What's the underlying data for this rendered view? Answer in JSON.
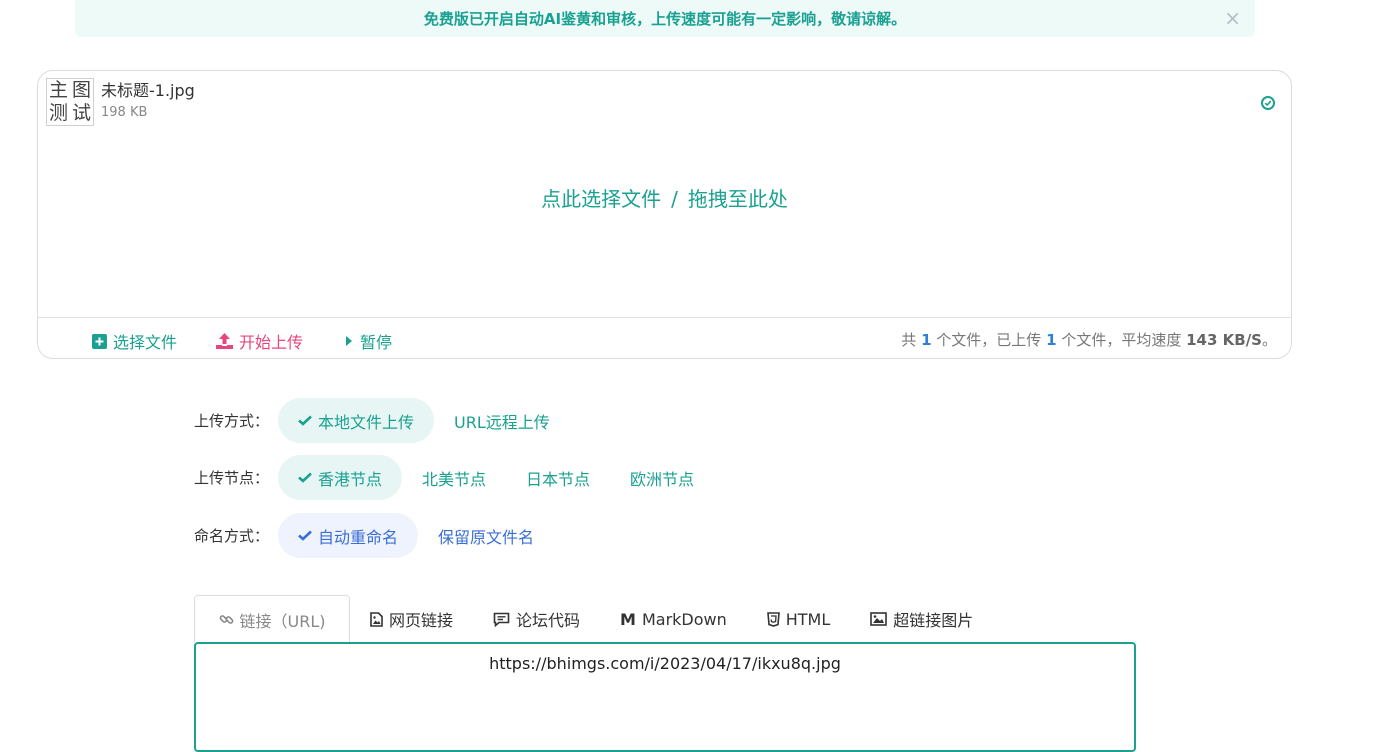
{
  "banner": {
    "text": "免费版已开启自动AI鉴黄和审核，上传速度可能有一定影响，敬请谅解。",
    "close": "×"
  },
  "upload": {
    "file": {
      "thumb_chars": [
        "主",
        "图",
        "测",
        "试"
      ],
      "name": "未标题-1.jpg",
      "size": "198 KB",
      "status": "check-circle-icon"
    },
    "drop": {
      "select": "点此选择文件",
      "sep": "/",
      "drag": "拖拽至此处"
    },
    "footer": {
      "select_label": "选择文件",
      "start_label": "开始上传",
      "pause_label": "暂停",
      "stats": {
        "prefix": "共",
        "total": "1",
        "mid": "个文件，已上传",
        "uploaded": "1",
        "speed_prefix": "个文件，平均速度",
        "speed": "143 KB/S",
        "suffix": "。"
      }
    }
  },
  "options": {
    "method": {
      "label": "上传方式：",
      "choices": [
        "本地文件上传",
        "URL远程上传"
      ],
      "selected": "本地文件上传"
    },
    "node": {
      "label": "上传节点：",
      "choices": [
        "香港节点",
        "北美节点",
        "日本节点",
        "欧洲节点"
      ],
      "selected": "香港节点"
    },
    "naming": {
      "label": "命名方式：",
      "choices": [
        "自动重命名",
        "保留原文件名"
      ],
      "selected": "自动重命名"
    }
  },
  "tabs": [
    {
      "label": "链接（URL)",
      "icon": "link-icon"
    },
    {
      "label": "网页链接",
      "icon": "image-file-icon"
    },
    {
      "label": "论坛代码",
      "icon": "comment-icon"
    },
    {
      "label": "MarkDown",
      "icon": "markdown-icon"
    },
    {
      "label": "HTML",
      "icon": "html5-icon"
    },
    {
      "label": "超链接图片",
      "icon": "image-icon"
    }
  ],
  "result": {
    "url": "https://bhimgs.com/i/2023/04/17/ikxu8q.jpg"
  },
  "colors": {
    "accent": "#1aa191",
    "start": "#e8467c",
    "blue": "#3b6fd4"
  }
}
